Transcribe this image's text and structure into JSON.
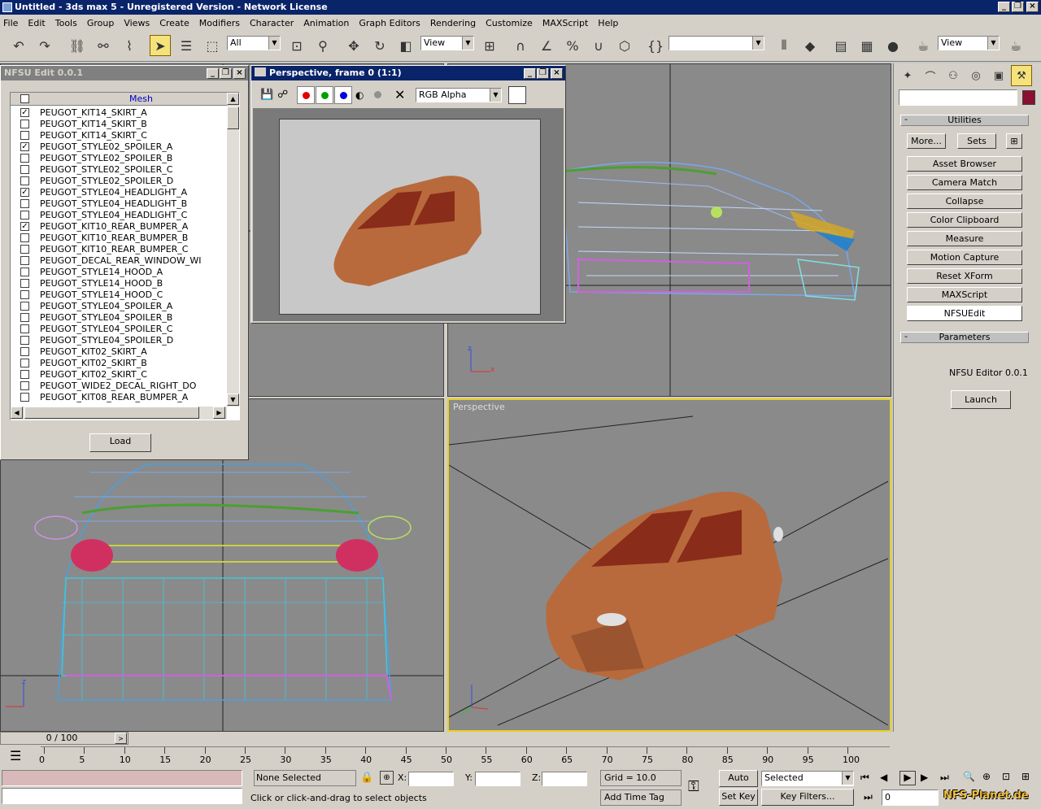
{
  "app": {
    "title": "Untitled - 3ds max 5 - Unregistered Version - Network License"
  },
  "menu": [
    "File",
    "Edit",
    "Tools",
    "Group",
    "Views",
    "Create",
    "Modifiers",
    "Character",
    "Animation",
    "Graph Editors",
    "Rendering",
    "Customize",
    "MAXScript",
    "Help"
  ],
  "toolbar": {
    "selection_filter": "All",
    "ref_coord": "View",
    "named_sel": "",
    "view_combo": "View"
  },
  "nfsu_dialog": {
    "title": "NFSU Edit 0.0.1",
    "column_header": "Mesh",
    "items": [
      {
        "name": "PEUGOT_KIT14_SKIRT_A",
        "checked": true
      },
      {
        "name": "PEUGOT_KIT14_SKIRT_B",
        "checked": false
      },
      {
        "name": "PEUGOT_KIT14_SKIRT_C",
        "checked": false
      },
      {
        "name": "PEUGOT_STYLE02_SPOILER_A",
        "checked": true
      },
      {
        "name": "PEUGOT_STYLE02_SPOILER_B",
        "checked": false
      },
      {
        "name": "PEUGOT_STYLE02_SPOILER_C",
        "checked": false
      },
      {
        "name": "PEUGOT_STYLE02_SPOILER_D",
        "checked": false
      },
      {
        "name": "PEUGOT_STYLE04_HEADLIGHT_A",
        "checked": true
      },
      {
        "name": "PEUGOT_STYLE04_HEADLIGHT_B",
        "checked": false
      },
      {
        "name": "PEUGOT_STYLE04_HEADLIGHT_C",
        "checked": false
      },
      {
        "name": "PEUGOT_KIT10_REAR_BUMPER_A",
        "checked": true
      },
      {
        "name": "PEUGOT_KIT10_REAR_BUMPER_B",
        "checked": false
      },
      {
        "name": "PEUGOT_KIT10_REAR_BUMPER_C",
        "checked": false
      },
      {
        "name": "PEUGOT_DECAL_REAR_WINDOW_WI",
        "checked": false
      },
      {
        "name": "PEUGOT_STYLE14_HOOD_A",
        "checked": false
      },
      {
        "name": "PEUGOT_STYLE14_HOOD_B",
        "checked": false
      },
      {
        "name": "PEUGOT_STYLE14_HOOD_C",
        "checked": false
      },
      {
        "name": "PEUGOT_STYLE04_SPOILER_A",
        "checked": false
      },
      {
        "name": "PEUGOT_STYLE04_SPOILER_B",
        "checked": false
      },
      {
        "name": "PEUGOT_STYLE04_SPOILER_C",
        "checked": false
      },
      {
        "name": "PEUGOT_STYLE04_SPOILER_D",
        "checked": false
      },
      {
        "name": "PEUGOT_KIT02_SKIRT_A",
        "checked": false
      },
      {
        "name": "PEUGOT_KIT02_SKIRT_B",
        "checked": false
      },
      {
        "name": "PEUGOT_KIT02_SKIRT_C",
        "checked": false
      },
      {
        "name": "PEUGOT_WIDE2_DECAL_RIGHT_DO",
        "checked": false
      },
      {
        "name": "PEUGOT_KIT08_REAR_BUMPER_A",
        "checked": false
      }
    ],
    "load_label": "Load"
  },
  "render_window": {
    "title": "Perspective, frame 0 (1:1)",
    "channel": "RGB Alpha"
  },
  "viewports": {
    "perspective_label": "Perspective"
  },
  "command_panel": {
    "utilities_header": "Utilities",
    "more_label": "More...",
    "sets_label": "Sets",
    "utilities": [
      "Asset Browser",
      "Camera Match",
      "Collapse",
      "Color Clipboard",
      "Measure",
      "Motion Capture",
      "Reset XForm",
      "MAXScript",
      "NFSUEdit"
    ],
    "parameters_header": "Parameters",
    "editor_label": "NFSU Editor 0.0.1",
    "launch_label": "Launch",
    "swatch_color": "#8b1030"
  },
  "timeline": {
    "frame_display": "0 / 100",
    "ticks": [
      "0",
      "5",
      "10",
      "15",
      "20",
      "25",
      "30",
      "35",
      "40",
      "45",
      "50",
      "55",
      "60",
      "65",
      "70",
      "75",
      "80",
      "85",
      "90",
      "95",
      "100"
    ]
  },
  "status": {
    "selection": "None Selected",
    "x_label": "X:",
    "y_label": "Y:",
    "z_label": "Z:",
    "grid": "Grid = 10.0",
    "prompt": "Click or click-and-drag to select objects",
    "add_time_tag": "Add Time Tag",
    "auto_key": "Auto Key",
    "set_key": "Set Key",
    "selected": "Selected",
    "key_filters": "Key Filters...",
    "frame": "0",
    "watermark": "NFS-Planet.de"
  }
}
